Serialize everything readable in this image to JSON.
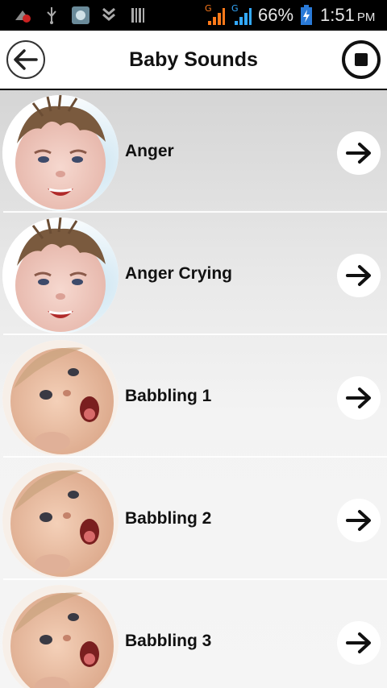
{
  "status_bar": {
    "battery_percent": "66%",
    "time": "1:51",
    "ampm": "PM",
    "signal_1_label": "G",
    "signal_2_label": "G"
  },
  "app_bar": {
    "title": "Baby Sounds"
  },
  "sounds": [
    {
      "label": "Anger",
      "face": "angry-baby"
    },
    {
      "label": "Anger Crying",
      "face": "angry-baby"
    },
    {
      "label": "Babbling 1",
      "face": "babbling-baby"
    },
    {
      "label": "Babbling 2",
      "face": "babbling-baby"
    },
    {
      "label": "Babbling 3",
      "face": "babbling-baby"
    }
  ],
  "colors": {
    "status_bar_bg": "#000000",
    "signal_orange": "#ff7a1a",
    "signal_blue": "#33aaff",
    "text_dark": "#111111"
  }
}
